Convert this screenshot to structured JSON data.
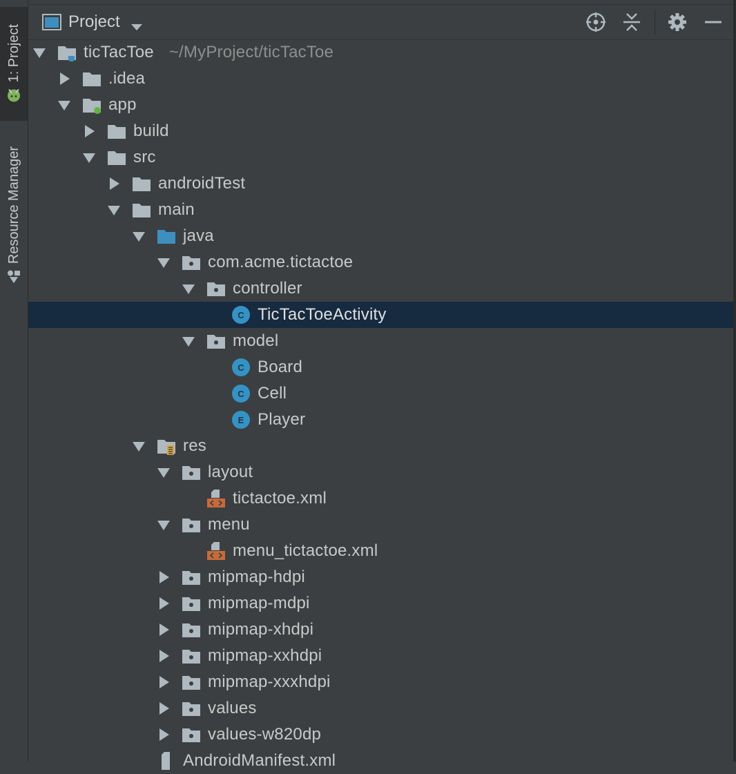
{
  "sidebar": {
    "tabs": [
      {
        "label": "1: Project",
        "active": true
      },
      {
        "label": "Resource Manager",
        "active": false
      }
    ]
  },
  "header": {
    "title": "Project",
    "icons": [
      "locate-icon",
      "collapse-all-icon",
      "gear-icon",
      "minimize-icon"
    ]
  },
  "tree": [
    {
      "label": "ticTacToe",
      "path": "~/MyProject/ticTacToe",
      "depth": 0,
      "state": "open",
      "icon": "module-folder"
    },
    {
      "label": ".idea",
      "depth": 1,
      "state": "closed",
      "icon": "folder"
    },
    {
      "label": "app",
      "depth": 1,
      "state": "open",
      "icon": "app-module"
    },
    {
      "label": "build",
      "depth": 2,
      "state": "closed",
      "icon": "folder"
    },
    {
      "label": "src",
      "depth": 2,
      "state": "open",
      "icon": "folder"
    },
    {
      "label": "androidTest",
      "depth": 3,
      "state": "closed",
      "icon": "folder"
    },
    {
      "label": "main",
      "depth": 3,
      "state": "open",
      "icon": "folder"
    },
    {
      "label": "java",
      "depth": 4,
      "state": "open",
      "icon": "source-folder"
    },
    {
      "label": "com.acme.tictactoe",
      "depth": 5,
      "state": "open",
      "icon": "package"
    },
    {
      "label": "controller",
      "depth": 6,
      "state": "open",
      "icon": "package"
    },
    {
      "label": "TicTacToeActivity",
      "depth": 7,
      "state": "leaf",
      "icon": "class",
      "badge": "C",
      "selected": true
    },
    {
      "label": "model",
      "depth": 6,
      "state": "open",
      "icon": "package"
    },
    {
      "label": "Board",
      "depth": 7,
      "state": "leaf",
      "icon": "class",
      "badge": "C"
    },
    {
      "label": "Cell",
      "depth": 7,
      "state": "leaf",
      "icon": "class",
      "badge": "C"
    },
    {
      "label": "Player",
      "depth": 7,
      "state": "leaf",
      "icon": "enum",
      "badge": "E"
    },
    {
      "label": "res",
      "depth": 4,
      "state": "open",
      "icon": "res-folder"
    },
    {
      "label": "layout",
      "depth": 5,
      "state": "open",
      "icon": "package"
    },
    {
      "label": "tictactoe.xml",
      "depth": 6,
      "state": "leaf",
      "icon": "xml"
    },
    {
      "label": "menu",
      "depth": 5,
      "state": "open",
      "icon": "package"
    },
    {
      "label": "menu_tictactoe.xml",
      "depth": 6,
      "state": "leaf",
      "icon": "xml"
    },
    {
      "label": "mipmap-hdpi",
      "depth": 5,
      "state": "closed",
      "icon": "package"
    },
    {
      "label": "mipmap-mdpi",
      "depth": 5,
      "state": "closed",
      "icon": "package"
    },
    {
      "label": "mipmap-xhdpi",
      "depth": 5,
      "state": "closed",
      "icon": "package"
    },
    {
      "label": "mipmap-xxhdpi",
      "depth": 5,
      "state": "closed",
      "icon": "package"
    },
    {
      "label": "mipmap-xxxhdpi",
      "depth": 5,
      "state": "closed",
      "icon": "package"
    },
    {
      "label": "values",
      "depth": 5,
      "state": "closed",
      "icon": "package"
    },
    {
      "label": "values-w820dp",
      "depth": 5,
      "state": "closed",
      "icon": "package"
    },
    {
      "label": "AndroidManifest.xml",
      "depth": 4,
      "state": "leaf",
      "icon": "manifest"
    }
  ],
  "colors": {
    "background": "#3c3f41",
    "selection": "#162a40",
    "folder": "#aeb9c0",
    "source_folder": "#3d8fbf",
    "class_badge": "#3592c4",
    "xml_orange": "#c76a3a",
    "app_dot": "#62b543"
  }
}
